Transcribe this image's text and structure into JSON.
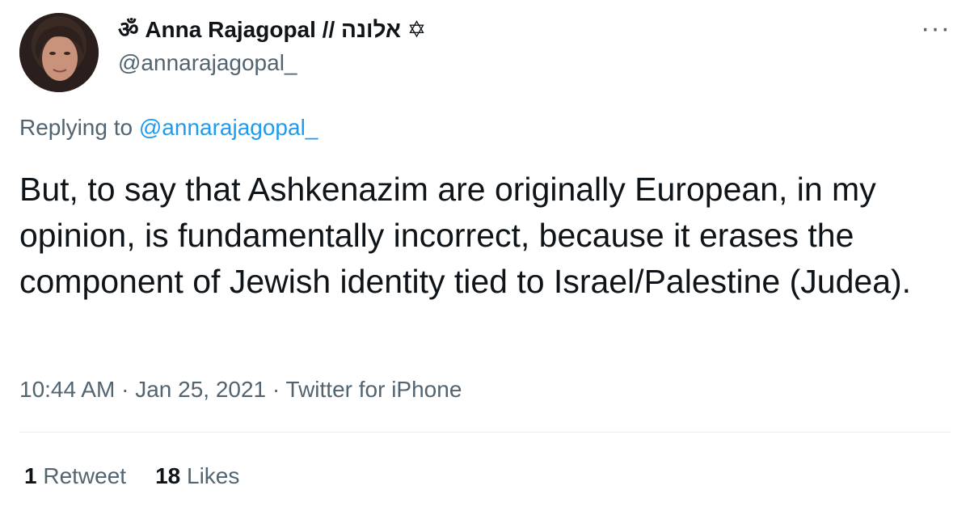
{
  "author": {
    "display_name": "ॐ Anna Rajagopal // אלונה ✡",
    "handle": "@annarajagopal_",
    "avatar_icon": "profile-photo"
  },
  "more_icon": "more-horizontal-icon",
  "reply": {
    "prefix": "Replying to ",
    "handle": "@annarajagopal_"
  },
  "tweet": {
    "text": "But, to say that Ashkenazim are originally European, in my opinion, is fundamentally incorrect, because it erases the component of Jewish identity tied to Israel/Palestine (Judea)."
  },
  "meta": {
    "time": "10:44 AM",
    "sep1": " · ",
    "date": "Jan 25, 2021",
    "sep2": " · ",
    "source": "Twitter for iPhone"
  },
  "stats": {
    "retweets_count": "1",
    "retweets_label": " Retweet",
    "likes_count": "18",
    "likes_label": " Likes"
  },
  "colors": {
    "text": "#0f1419",
    "secondary": "#536471",
    "link": "#1d9bf0",
    "divider": "#e6ecf0"
  }
}
